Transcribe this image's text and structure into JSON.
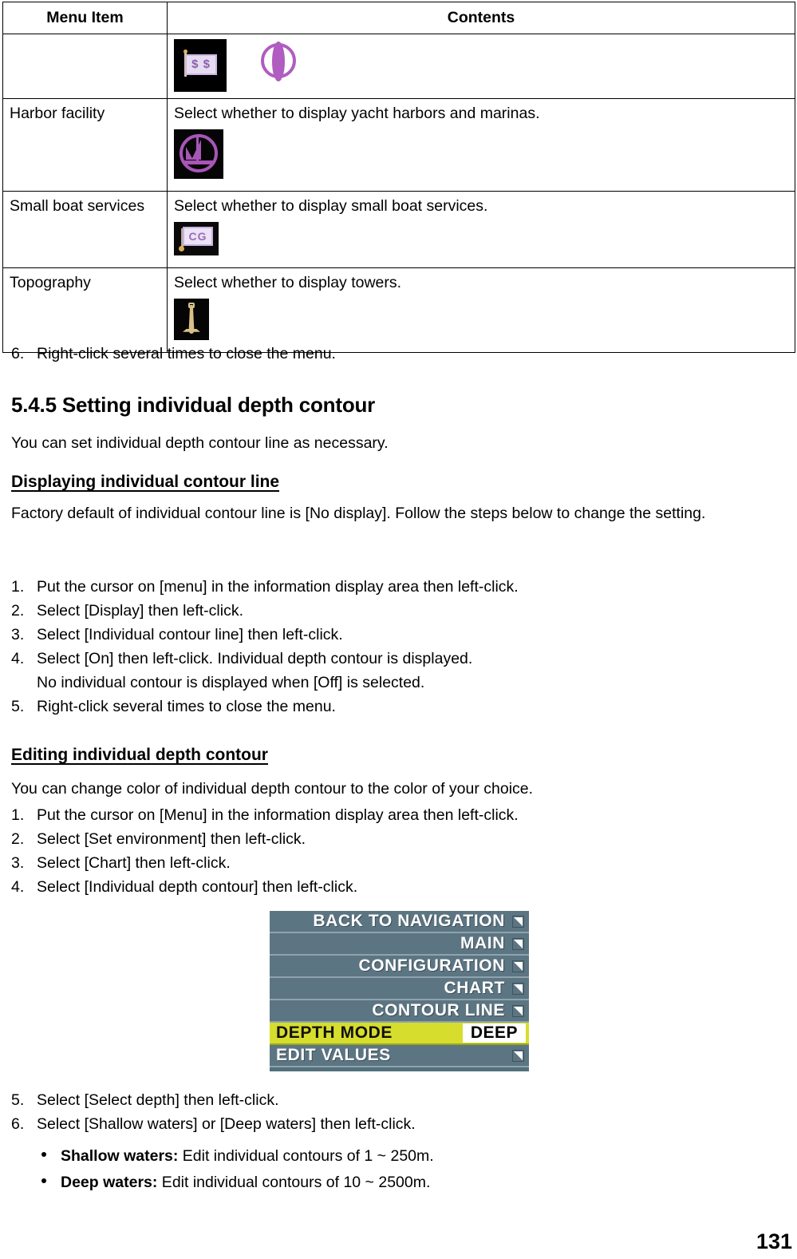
{
  "table": {
    "headers": [
      "Menu Item",
      "Contents"
    ],
    "rows": [
      {
        "item": "",
        "desc": "",
        "icons": [
          "dollar-sign-board-icon",
          "purple-lens-buoy-icon"
        ]
      },
      {
        "item": "Harbor facility",
        "desc": "Select whether to display yacht harbors and marinas.",
        "icons": [
          "sailboat-harbor-icon"
        ]
      },
      {
        "item": "Small boat services",
        "desc": "Select whether to display small boat services.",
        "icons": [
          "coast-guard-cg-icon"
        ]
      },
      {
        "item": "Topography",
        "desc": "Select whether to display towers.",
        "icons": [
          "tower-icon"
        ]
      }
    ],
    "icon_labels": {
      "dollar": "$ $",
      "cg": "CG"
    }
  },
  "step_after_table": {
    "num": "6.",
    "text": "Right-click several times to close the menu."
  },
  "section": {
    "heading": "5.4.5 Setting individual depth contour",
    "intro": "You can set individual depth contour line as necessary."
  },
  "displaying": {
    "heading": "Displaying individual contour line",
    "para": "Factory default of individual contour line is [No display]. Follow the steps below to change the setting.",
    "steps": [
      {
        "num": "1.",
        "text": "Put the cursor on [menu] in the information display area then left-click."
      },
      {
        "num": "2.",
        "text": "Select [Display] then left-click."
      },
      {
        "num": "3.",
        "text": "Select [Individual contour line] then left-click."
      },
      {
        "num": "4.",
        "text": "Select [On] then left-click. Individual depth contour is displayed."
      }
    ],
    "continuation": "No individual contour is displayed when [Off] is selected.",
    "last_step": {
      "num": "5.",
      "text": "Right-click several times to close the menu."
    }
  },
  "editing": {
    "heading": "Editing individual depth contour",
    "para": "You can change color of individual depth contour to the color of your choice.",
    "steps": [
      {
        "num": "1.",
        "text": "Put the cursor on [Menu] in the information display area then left-click."
      },
      {
        "num": "2.",
        "text": "Select [Set environment] then left-click."
      },
      {
        "num": "3.",
        "text": "Select [Chart] then left-click."
      },
      {
        "num": "4.",
        "text": "Select [Individual depth contour] then left-click."
      }
    ],
    "steps_after": [
      {
        "num": "5.",
        "text": "Select [Select depth] then left-click."
      },
      {
        "num": "6.",
        "text": "Select [Shallow waters] or [Deep waters] then left-click."
      }
    ],
    "bullets": [
      {
        "label": "Shallow waters:",
        "text": " Edit individual contours of 1 ~ 250m."
      },
      {
        "label": "Deep waters:",
        "text": " Edit individual contours of 10 ~ 2500m."
      }
    ]
  },
  "menu_screenshot": {
    "rows": [
      {
        "label": "BACK TO NAVIGATION",
        "has_arrow": true,
        "highlight": false,
        "align": "right",
        "value": ""
      },
      {
        "label": "MAIN",
        "has_arrow": true,
        "highlight": false,
        "align": "right",
        "value": ""
      },
      {
        "label": "CONFIGURATION",
        "has_arrow": true,
        "highlight": false,
        "align": "right",
        "value": ""
      },
      {
        "label": "CHART",
        "has_arrow": true,
        "highlight": false,
        "align": "right",
        "value": ""
      },
      {
        "label": "CONTOUR LINE",
        "has_arrow": true,
        "highlight": false,
        "align": "right",
        "value": ""
      },
      {
        "label": "DEPTH MODE",
        "has_arrow": false,
        "highlight": true,
        "align": "left",
        "value": "DEEP"
      },
      {
        "label": "EDIT VALUES",
        "has_arrow": true,
        "highlight": false,
        "align": "left",
        "value": ""
      }
    ],
    "colors": {
      "menu_bg": "#5c7582",
      "highlight_bg": "#d7dd2c",
      "text": "#ffffff",
      "value_bg": "#ffffff"
    },
    "cursor": "mouse-pointer-icon"
  },
  "page_number": "131"
}
